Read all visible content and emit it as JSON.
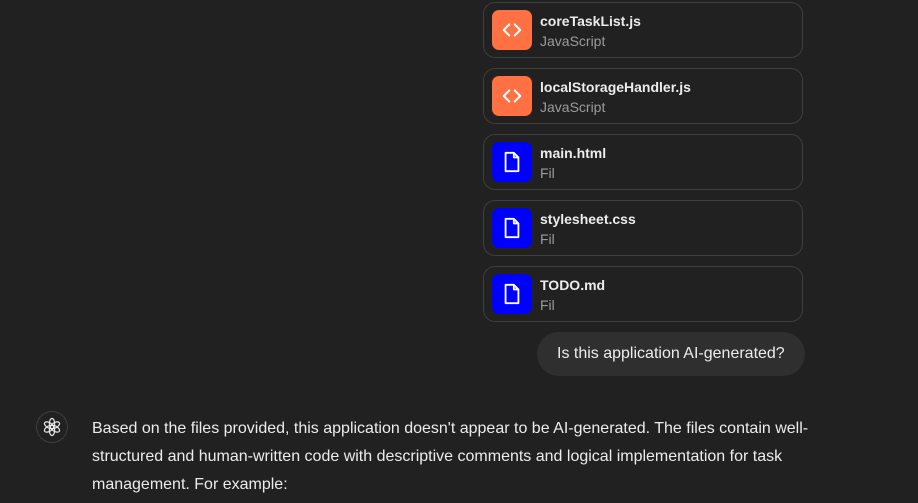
{
  "colors": {
    "background": "#212121",
    "code_icon_bg": "#ff7043",
    "file_icon_bg": "#0000ff",
    "card_border": "#3e3e3e",
    "user_bubble_bg": "#2f2f2f",
    "text_primary": "#ececec",
    "text_secondary": "#9b9b9b"
  },
  "attachments": [
    {
      "name": "coreTaskList.js",
      "type": "JavaScript",
      "icon": "code-icon"
    },
    {
      "name": "localStorageHandler.js",
      "type": "JavaScript",
      "icon": "code-icon"
    },
    {
      "name": "main.html",
      "type": "Fil",
      "icon": "document-icon"
    },
    {
      "name": "stylesheet.css",
      "type": "Fil",
      "icon": "document-icon"
    },
    {
      "name": "TODO.md",
      "type": "Fil",
      "icon": "document-icon"
    }
  ],
  "user_message": {
    "text": "Is this application AI-generated?"
  },
  "assistant_message": {
    "avatar_icon": "openai-logo-icon",
    "text": "Based on the files provided, this application doesn't appear to be AI-generated. The files contain well-structured and human-written code with descriptive comments and logical implementation for task management. For example:"
  }
}
